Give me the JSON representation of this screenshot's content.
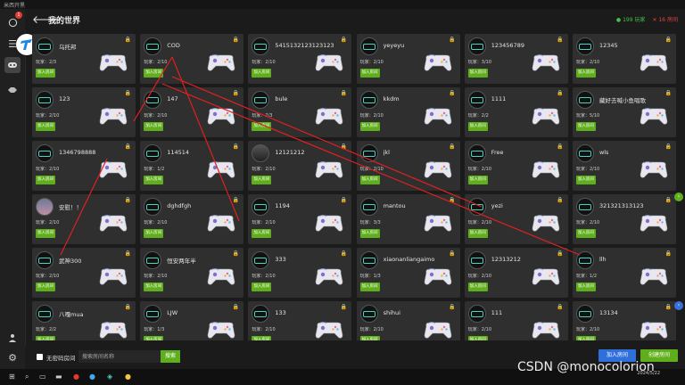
{
  "app": {
    "name": "米西开黑"
  },
  "header": {
    "title": "我的世界",
    "online_count": "199",
    "online_label": "玩家",
    "offline_count": "16",
    "offline_label": "房间"
  },
  "sidebar": {
    "chat_badge": "1"
  },
  "card_labels": {
    "players_prefix": "玩家：",
    "join": "加入房间"
  },
  "rooms": [
    {
      "name": "乌托邦",
      "players": "2/3",
      "avatar": "goggles"
    },
    {
      "name": "COD",
      "players": "2/10",
      "avatar": "goggles"
    },
    {
      "name": "5415132123123123",
      "players": "2/10",
      "avatar": "goggles"
    },
    {
      "name": "yeyeyu",
      "players": "2/10",
      "avatar": "goggles"
    },
    {
      "name": "123456789",
      "players": "3/10",
      "avatar": "goggles"
    },
    {
      "name": "12345",
      "players": "2/10",
      "avatar": "goggles"
    },
    {
      "name": "123",
      "players": "2/10",
      "avatar": "goggles"
    },
    {
      "name": "147",
      "players": "2/10",
      "avatar": "goggles"
    },
    {
      "name": "bule",
      "players": "2/3",
      "avatar": "goggles"
    },
    {
      "name": "kkdm",
      "players": "2/10",
      "avatar": "goggles"
    },
    {
      "name": "1111",
      "players": "2/2",
      "avatar": "goggles"
    },
    {
      "name": "藏好去喊小鱼唱歌",
      "players": "5/10",
      "avatar": "goggles"
    },
    {
      "name": "1346798888",
      "players": "2/10",
      "avatar": "goggles"
    },
    {
      "name": "114514",
      "players": "1/2",
      "avatar": "goggles"
    },
    {
      "name": "12121212",
      "players": "2/10",
      "avatar": "figure"
    },
    {
      "name": "jkl",
      "players": "2/10",
      "avatar": "goggles"
    },
    {
      "name": "Free",
      "players": "2/10",
      "avatar": "goggles"
    },
    {
      "name": "wls",
      "players": "2/10",
      "avatar": "goggles"
    },
    {
      "name": "安慰！！",
      "players": "2/10",
      "avatar": "photo"
    },
    {
      "name": "dghdfgh",
      "players": "2/10",
      "avatar": "goggles"
    },
    {
      "name": "1194",
      "players": "2/10",
      "avatar": "goggles"
    },
    {
      "name": "mantou",
      "players": "3/3",
      "avatar": "goggles"
    },
    {
      "name": "yezi",
      "players": "2/10",
      "avatar": "goggles"
    },
    {
      "name": "321321313123",
      "players": "2/10",
      "avatar": "goggles"
    },
    {
      "name": "武神300",
      "players": "2/10",
      "avatar": "goggles"
    },
    {
      "name": "恒安两年半",
      "players": "2/10",
      "avatar": "goggles"
    },
    {
      "name": "333",
      "players": "2/10",
      "avatar": "goggles"
    },
    {
      "name": "xiaonanliangaimo",
      "players": "1/3",
      "avatar": "goggles"
    },
    {
      "name": "12313212",
      "players": "2/10",
      "avatar": "goggles"
    },
    {
      "name": "llh",
      "players": "1/2",
      "avatar": "goggles"
    },
    {
      "name": "八嘎mua",
      "players": "2/2",
      "avatar": "goggles"
    },
    {
      "name": "LJW",
      "players": "1/3",
      "avatar": "goggles"
    },
    {
      "name": "133",
      "players": "2/10",
      "avatar": "goggles"
    },
    {
      "name": "shihui",
      "players": "2/10",
      "avatar": "goggles"
    },
    {
      "name": "111",
      "players": "2/10",
      "avatar": "goggles"
    },
    {
      "name": "13134",
      "players": "2/10",
      "avatar": "goggles"
    }
  ],
  "footer": {
    "nopassword_label": "无密码房间",
    "search_placeholder": "搜索房间名称",
    "search_button": "搜索",
    "join_button": "加入房间",
    "create_button": "创建房间"
  },
  "taskbar": {
    "date": "2024/5/22"
  },
  "watermark": "CSDN @monocolorion",
  "colors": {
    "accent_green": "#5fae1b",
    "accent_blue": "#2f6fdc",
    "arrow_red": "#e02020"
  }
}
